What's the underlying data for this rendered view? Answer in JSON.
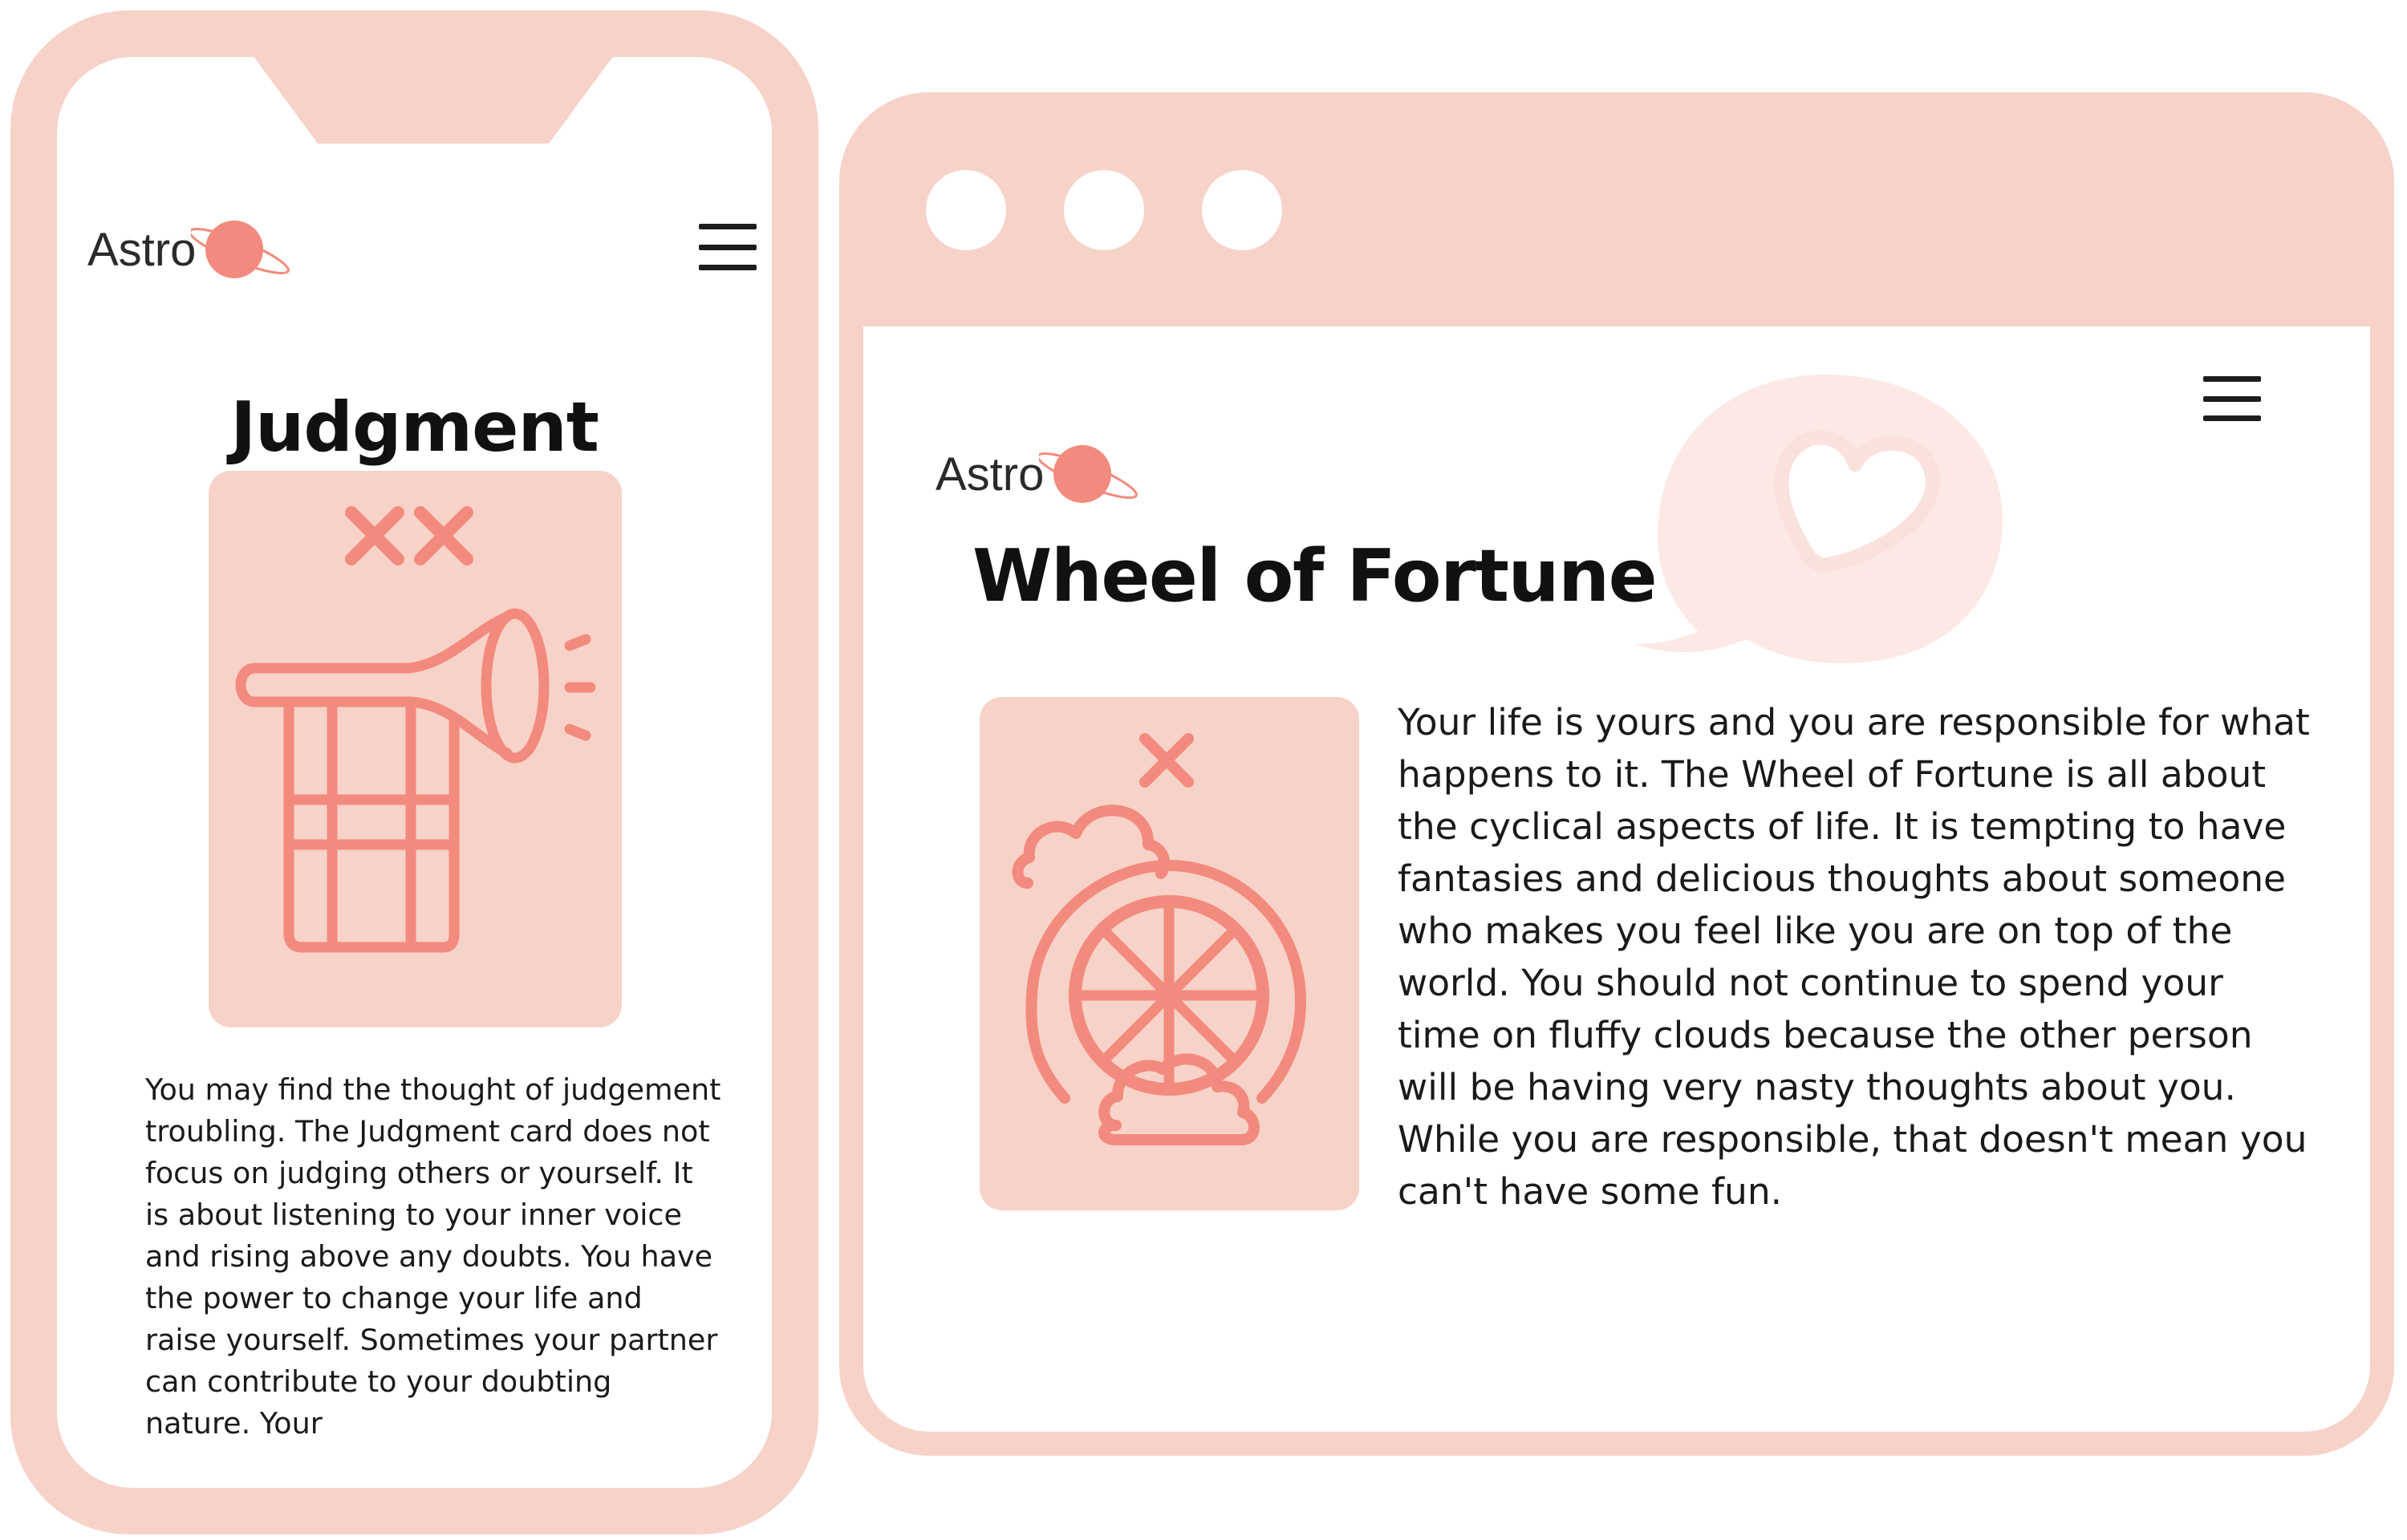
{
  "colors": {
    "frame": "#f7d2c8",
    "accent": "#f28b7d",
    "text": "#111111",
    "background": "#ffffff"
  },
  "mobile": {
    "logo_text": "Astro",
    "logo_icon": "planet-icon",
    "menu_icon": "hamburger-menu-icon",
    "title": "Judgment",
    "card_icon": "trumpet-judgment-icon",
    "body": "You may find the thought of judgement troubling. The Judgment card does not focus on judging others or yourself. It is about listening to your inner voice and rising above any doubts. You have the power to change your life and raise yourself. Sometimes your partner can contribute to your doubting nature. Your"
  },
  "desktop": {
    "window_controls": [
      "window-dot-1",
      "window-dot-2",
      "window-dot-3"
    ],
    "logo_text": "Astro",
    "logo_icon": "planet-icon",
    "menu_icon": "hamburger-menu-icon",
    "decoration_icon": "heart-speech-bubble-icon",
    "title": "Wheel of Fortune",
    "card_icon": "wheel-of-fortune-icon",
    "body": "Your life is yours and you are responsible for what happens to it. The Wheel of Fortune is all about the cyclical aspects of life. It is tempting to have fantasies and delicious thoughts about someone who makes you feel like you are on top of the world. You should not continue to spend your time on fluffy clouds because the other person will be having very nasty thoughts about you. While you are responsible, that doesn't mean you can't have some fun."
  }
}
